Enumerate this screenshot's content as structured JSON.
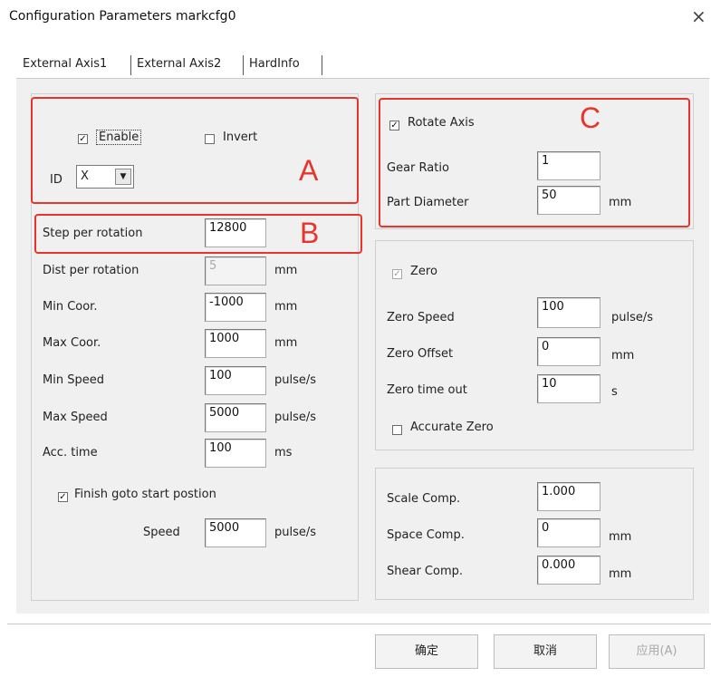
{
  "window": {
    "title": "Configuration Parameters markcfg0",
    "close_label": "×"
  },
  "tabs": [
    {
      "label": "External Axis1",
      "active": true
    },
    {
      "label": "External Axis2",
      "active": false
    },
    {
      "label": "HardInfo",
      "active": false
    }
  ],
  "group_a": {
    "enable": {
      "label": "Enable",
      "checked": true
    },
    "invert": {
      "label": "Invert",
      "checked": false
    },
    "id": {
      "label": "ID",
      "value": "X"
    }
  },
  "axis": {
    "step_per_rotation": {
      "label": "Step per rotation",
      "value": "12800"
    },
    "dist_per_rotation": {
      "label": "Dist per rotation",
      "value": "5",
      "unit": "mm"
    },
    "min_coor": {
      "label": "Min Coor.",
      "value": "-1000",
      "unit": "mm"
    },
    "max_coor": {
      "label": "Max Coor.",
      "value": "1000",
      "unit": "mm"
    },
    "min_speed": {
      "label": "Min Speed",
      "value": "100",
      "unit": "pulse/s"
    },
    "max_speed": {
      "label": "Max Speed",
      "value": "5000",
      "unit": "pulse/s"
    },
    "acc_time": {
      "label": "Acc. time",
      "value": "100",
      "unit": "ms"
    },
    "finish_goto": {
      "label": "Finish goto start postion",
      "checked": true
    },
    "speed": {
      "label": "Speed",
      "value": "5000",
      "unit": "pulse/s"
    }
  },
  "rotate": {
    "rotate_axis": {
      "label": "Rotate Axis",
      "checked": true
    },
    "gear_ratio": {
      "label": "Gear Ratio",
      "value": "1"
    },
    "part_diameter": {
      "label": "Part Diameter",
      "value": "50",
      "unit": "mm"
    }
  },
  "zero": {
    "zero": {
      "label": "Zero",
      "checked": true
    },
    "zero_speed": {
      "label": "Zero Speed",
      "value": "100",
      "unit": "pulse/s"
    },
    "zero_offset": {
      "label": "Zero Offset",
      "value": "0",
      "unit": "mm"
    },
    "zero_timeout": {
      "label": "Zero time out",
      "value": "10",
      "unit": "s"
    },
    "accurate_zero": {
      "label": "Accurate Zero",
      "checked": false
    }
  },
  "comp": {
    "scale": {
      "label": "Scale Comp.",
      "value": "1.000"
    },
    "space": {
      "label": "Space Comp.",
      "value": "0",
      "unit": "mm"
    },
    "shear": {
      "label": "Shear Comp.",
      "value": "0.000",
      "unit": "mm"
    }
  },
  "annotations": {
    "a": "A",
    "b": "B",
    "c": "C"
  },
  "annotation_color": "#e8342a",
  "buttons": {
    "ok": "确定",
    "cancel": "取消",
    "apply": "应用(A)"
  }
}
